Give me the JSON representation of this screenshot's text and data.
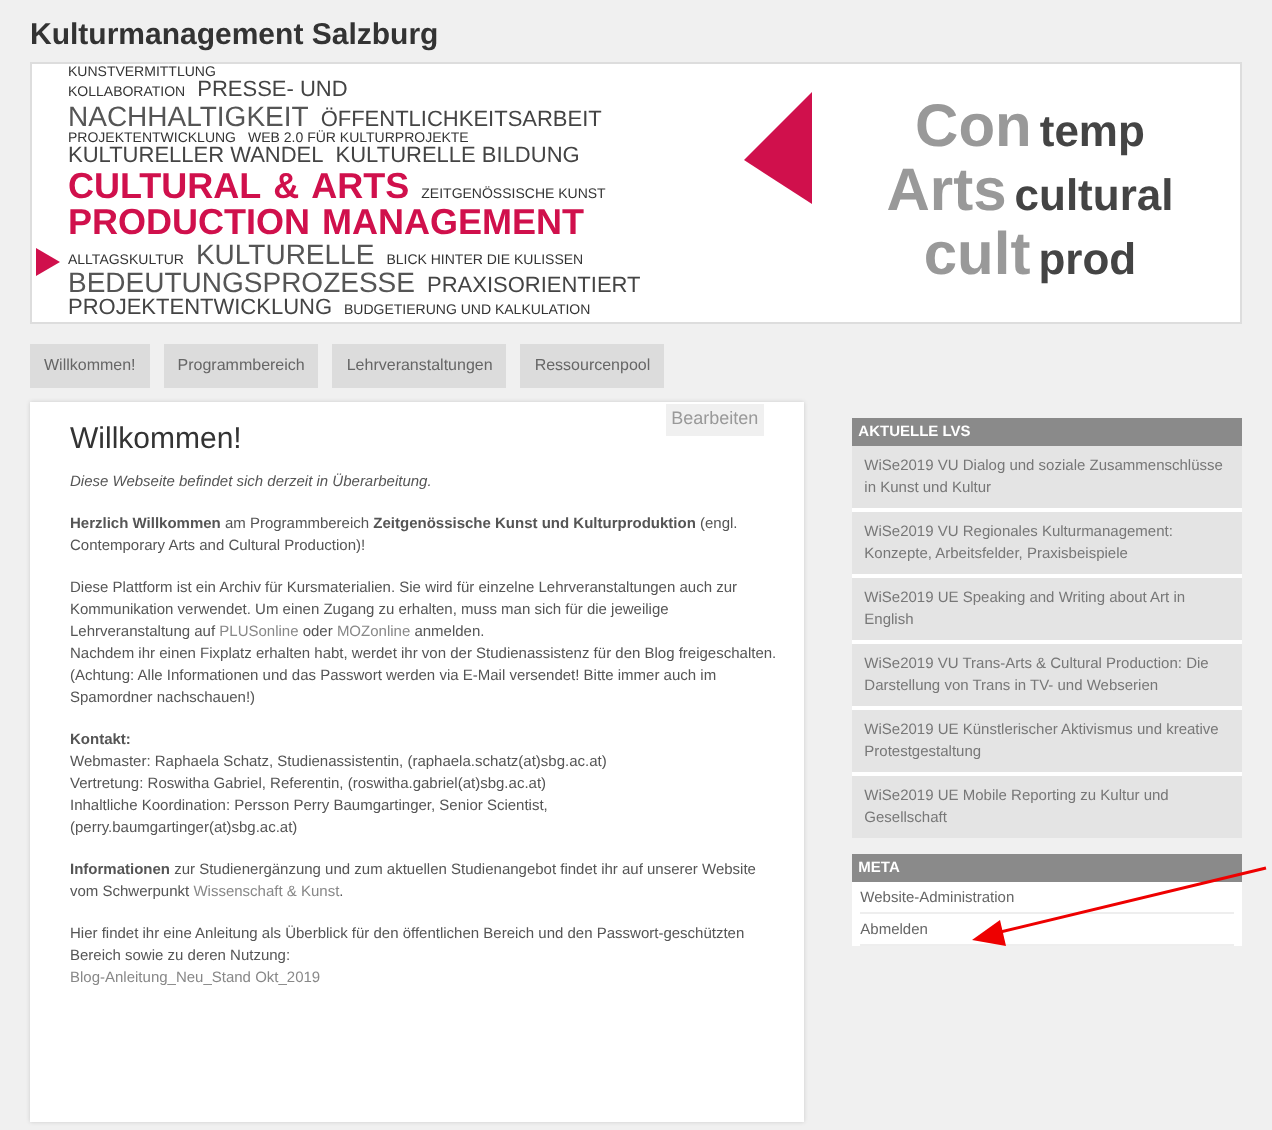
{
  "site_title": "Kulturmanagement Salzburg",
  "banner": {
    "rows": [
      [
        {
          "text": "KUNSTVERMITTLUNG",
          "kind": "small"
        }
      ],
      [
        {
          "text": "KOLLABORATION",
          "kind": "small"
        },
        {
          "text": "PRESSE- UND",
          "kind": "medium"
        }
      ],
      [
        {
          "text": "NACHHALTIGKEIT",
          "kind": "big"
        },
        {
          "text": "ÖFFENTLICHKEITSARBEIT",
          "kind": "medium"
        }
      ],
      [
        {
          "text": "PROJEKTENTWICKLUNG",
          "kind": "small"
        },
        {
          "text": "WEB 2.0 FÜR KULTURPROJEKTE",
          "kind": "small"
        }
      ],
      [
        {
          "text": "KULTURELLER WANDEL",
          "kind": "medium"
        },
        {
          "text": "KULTURELLE BILDUNG",
          "kind": "medium"
        }
      ],
      [
        {
          "text": "CULTURAL",
          "kind": "main"
        },
        {
          "text": "&",
          "kind": "main"
        },
        {
          "text": "ARTS",
          "kind": "main"
        },
        {
          "text": "ZEITGENÖSSISCHE KUNST",
          "kind": "small"
        }
      ],
      [
        {
          "text": "PRODUCTION",
          "kind": "main"
        },
        {
          "text": "MANAGEMENT",
          "kind": "main"
        }
      ],
      [
        {
          "text": "ALLTAGSKULTUR",
          "kind": "small"
        },
        {
          "text": "KULTURELLE",
          "kind": "big"
        },
        {
          "text": "BLICK HINTER DIE KULISSEN",
          "kind": "small"
        }
      ],
      [
        {
          "text": "BEDEUTUNGSPROZESSE",
          "kind": "big"
        },
        {
          "text": "PRAXISORIENTIERT",
          "kind": "medium"
        }
      ],
      [
        {
          "text": "PROJEKTENTWICKLUNG",
          "kind": "medium"
        },
        {
          "text": "BUDGETIERUNG UND KALKULATION",
          "kind": "small"
        }
      ]
    ],
    "logo_rows": [
      [
        "Con",
        "temp"
      ],
      [
        "Arts",
        "cultural"
      ],
      [
        "cult",
        "prod"
      ]
    ]
  },
  "nav": [
    "Willkommen!",
    "Programmbereich",
    "Lehrveranstaltungen",
    "Ressourcenpool"
  ],
  "page": {
    "title": "Willkommen!",
    "edit_button": "Bearbeiten",
    "blocks": [
      [
        [
          {
            "kind": "italic",
            "text": "Diese Webseite befindet sich derzeit in Überarbeitung."
          }
        ]
      ],
      [
        [
          {
            "kind": "text",
            "text": "**Herzlich Willkommen** am Programmbereich **Zeitgenössische Kunst und Kulturproduktion** (engl. Contemporary Arts and Cultural Production)!"
          }
        ]
      ],
      [
        [
          {
            "kind": "text",
            "text": "Diese Plattform ist ein Archiv für Kursmaterialien. Sie wird für einzelne Lehrveranstaltungen auch zur Kommunikation verwendet. Um einen Zugang zu erhalten, muss man sich für die jeweilige Lehrveranstaltung auf "
          },
          {
            "kind": "link",
            "text": "PLUSonline"
          },
          {
            "kind": "text",
            "text": " oder "
          },
          {
            "kind": "link",
            "text": "MOZonline"
          },
          {
            "kind": "text",
            "text": " anmelden."
          }
        ],
        [
          {
            "kind": "text",
            "text": "Nachdem ihr einen Fixplatz erhalten habt, werdet ihr von der Studienassistenz für den Blog freigeschalten."
          }
        ],
        [
          {
            "kind": "text",
            "text": "(Achtung: Alle Informationen und das Passwort werden via E-Mail versendet! Bitte immer auch im Spamordner nachschauen!)"
          }
        ]
      ],
      [
        [
          {
            "kind": "strong",
            "text": "Kontakt:"
          }
        ],
        [
          {
            "kind": "text",
            "text": "Webmaster: Raphaela Schatz, Studienassistentin, (raphaela.schatz(at)sbg.ac.at)"
          }
        ],
        [
          {
            "kind": "text",
            "text": "Vertretung: Roswitha Gabriel, Referentin, (roswitha.gabriel(at)sbg.ac.at)"
          }
        ],
        [
          {
            "kind": "text",
            "text": "Inhaltliche Koordination: Persson Perry Baumgartinger, Senior Scientist,"
          }
        ],
        [
          {
            "kind": "text",
            "text": "(perry.baumgartinger(at)sbg.ac.at)"
          }
        ]
      ],
      [
        [
          {
            "kind": "text",
            "text": "**Informationen** zur Studienergänzung und zum aktuellen Studienangebot findet ihr auf unserer Website vom Schwerpunkt "
          },
          {
            "kind": "link",
            "text": "Wissenschaft & Kunst"
          },
          {
            "kind": "text",
            "text": "."
          }
        ]
      ],
      [
        [
          {
            "kind": "text",
            "text": "Hier findet ihr eine Anleitung als Überblick für den öffentlichen Bereich und den Passwort-geschützten Bereich sowie zu deren Nutzung:"
          }
        ],
        [
          {
            "kind": "link",
            "text": "Blog-Anleitung_Neu_Stand Okt_2019"
          }
        ]
      ]
    ]
  },
  "sidebar": [
    {
      "title": "AKTUELLE LVS",
      "kind": "boxes",
      "items": [
        "WiSe2019 VU Dialog und soziale Zusammenschlüsse in Kunst und Kultur",
        "WiSe2019 VU Regionales Kulturmanagement: Konzepte, Arbeitsfelder, Praxisbeispiele",
        "WiSe2019 UE Speaking and Writing about Art in English",
        "WiSe2019 VU Trans-Arts & Cultural Production: Die Darstellung von Trans in TV- und Webserien",
        "WiSe2019 UE Künstlerischer Aktivismus und kreative Protestgestaltung",
        "WiSe2019 UE Mobile Reporting zu Kultur und Gesellschaft"
      ]
    },
    {
      "title": "META",
      "kind": "list",
      "items": [
        "Website-Administration",
        "Abmelden"
      ]
    }
  ]
}
